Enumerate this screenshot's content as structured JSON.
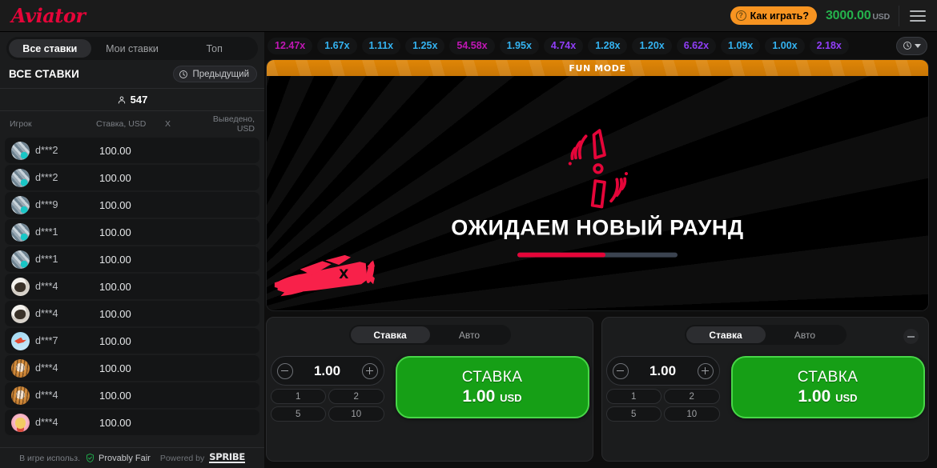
{
  "header": {
    "logo": "Aviator",
    "how_to_play": "Как играть?",
    "how_icon": "question-circle-icon",
    "balance": "3000.00",
    "currency": "USD",
    "menu_icon": "hamburger-menu-icon"
  },
  "sidebar": {
    "tabs": [
      {
        "label": "Все ставки",
        "active": true
      },
      {
        "label": "Мои ставки",
        "active": false
      },
      {
        "label": "Топ",
        "active": false
      }
    ],
    "section_title": "ВСЕ СТАВКИ",
    "previous_button": "Предыдущий",
    "previous_icon": "history-clock-icon",
    "player_count": "547",
    "player_count_icon": "person-icon",
    "columns": {
      "player": "Игрок",
      "bet": "Ставка, USD",
      "x": "X",
      "cashout": "Выведено, USD"
    },
    "rows": [
      {
        "player": "d***2",
        "bet": "100.00",
        "x": "",
        "cashout": "",
        "avatar": "money"
      },
      {
        "player": "d***2",
        "bet": "100.00",
        "x": "",
        "cashout": "",
        "avatar": "money"
      },
      {
        "player": "d***9",
        "bet": "100.00",
        "x": "",
        "cashout": "",
        "avatar": "money"
      },
      {
        "player": "d***1",
        "bet": "100.00",
        "x": "",
        "cashout": "",
        "avatar": "money"
      },
      {
        "player": "d***1",
        "bet": "100.00",
        "x": "",
        "cashout": "",
        "avatar": "money"
      },
      {
        "player": "d***4",
        "bet": "100.00",
        "x": "",
        "cashout": "",
        "avatar": "bird"
      },
      {
        "player": "d***4",
        "bet": "100.00",
        "x": "",
        "cashout": "",
        "avatar": "bird"
      },
      {
        "player": "d***7",
        "bet": "100.00",
        "x": "",
        "cashout": "",
        "avatar": "plane"
      },
      {
        "player": "d***4",
        "bet": "100.00",
        "x": "",
        "cashout": "",
        "avatar": "tiger"
      },
      {
        "player": "d***4",
        "bet": "100.00",
        "x": "",
        "cashout": "",
        "avatar": "tiger"
      },
      {
        "player": "d***4",
        "bet": "100.00",
        "x": "",
        "cashout": "",
        "avatar": "cat"
      }
    ],
    "footer": {
      "uses": "В игре использ.",
      "provably_fair": "Provably Fair",
      "shield_icon": "shield-check-icon",
      "powered_by": "Powered by",
      "brand": "SPRIBE"
    }
  },
  "history": {
    "items": [
      {
        "value": "12.47x",
        "tone": "pink"
      },
      {
        "value": "1.67x",
        "tone": "blue"
      },
      {
        "value": "1.11x",
        "tone": "blue"
      },
      {
        "value": "1.25x",
        "tone": "blue"
      },
      {
        "value": "54.58x",
        "tone": "pink"
      },
      {
        "value": "1.95x",
        "tone": "blue"
      },
      {
        "value": "4.74x",
        "tone": "purple"
      },
      {
        "value": "1.28x",
        "tone": "blue"
      },
      {
        "value": "1.20x",
        "tone": "blue"
      },
      {
        "value": "6.62x",
        "tone": "purple"
      },
      {
        "value": "1.09x",
        "tone": "blue"
      },
      {
        "value": "1.00x",
        "tone": "blue"
      },
      {
        "value": "2.18x",
        "tone": "purple"
      }
    ],
    "toggle_icon": "history-clock-icon",
    "caret_icon": "chevron-down-icon"
  },
  "game": {
    "fun_mode": "FUN MODE",
    "status": "ОЖИДАЕМ НОВЫЙ РАУНД",
    "progress_percent": 55,
    "propeller_icon": "spinning-propeller-icon",
    "plane_icon": "red-plane-icon"
  },
  "bet_panels": [
    {
      "tabs": [
        {
          "label": "Ставка",
          "active": true
        },
        {
          "label": "Авто",
          "active": false
        }
      ],
      "amount": "1.00",
      "minus_icon": "minus-circle-icon",
      "plus_icon": "plus-circle-icon",
      "quick_amounts": [
        "1",
        "2",
        "5",
        "10"
      ],
      "bet_label": "СТАВКА",
      "bet_amount": "1.00",
      "bet_currency": "USD",
      "has_collapse": false
    },
    {
      "tabs": [
        {
          "label": "Ставка",
          "active": true
        },
        {
          "label": "Авто",
          "active": false
        }
      ],
      "amount": "1.00",
      "minus_icon": "minus-circle-icon",
      "plus_icon": "plus-circle-icon",
      "quick_amounts": [
        "1",
        "2",
        "5",
        "10"
      ],
      "bet_label": "СТАВКА",
      "bet_amount": "1.00",
      "bet_currency": "USD",
      "has_collapse": true,
      "collapse_icon": "minimize-icon"
    }
  ],
  "colors": {
    "accent_red": "#e50539",
    "green": "#169f16",
    "orange": "#e08607",
    "blue_mult": "#34b3f1",
    "purple_mult": "#913ef8",
    "pink_mult": "#c017b4"
  }
}
